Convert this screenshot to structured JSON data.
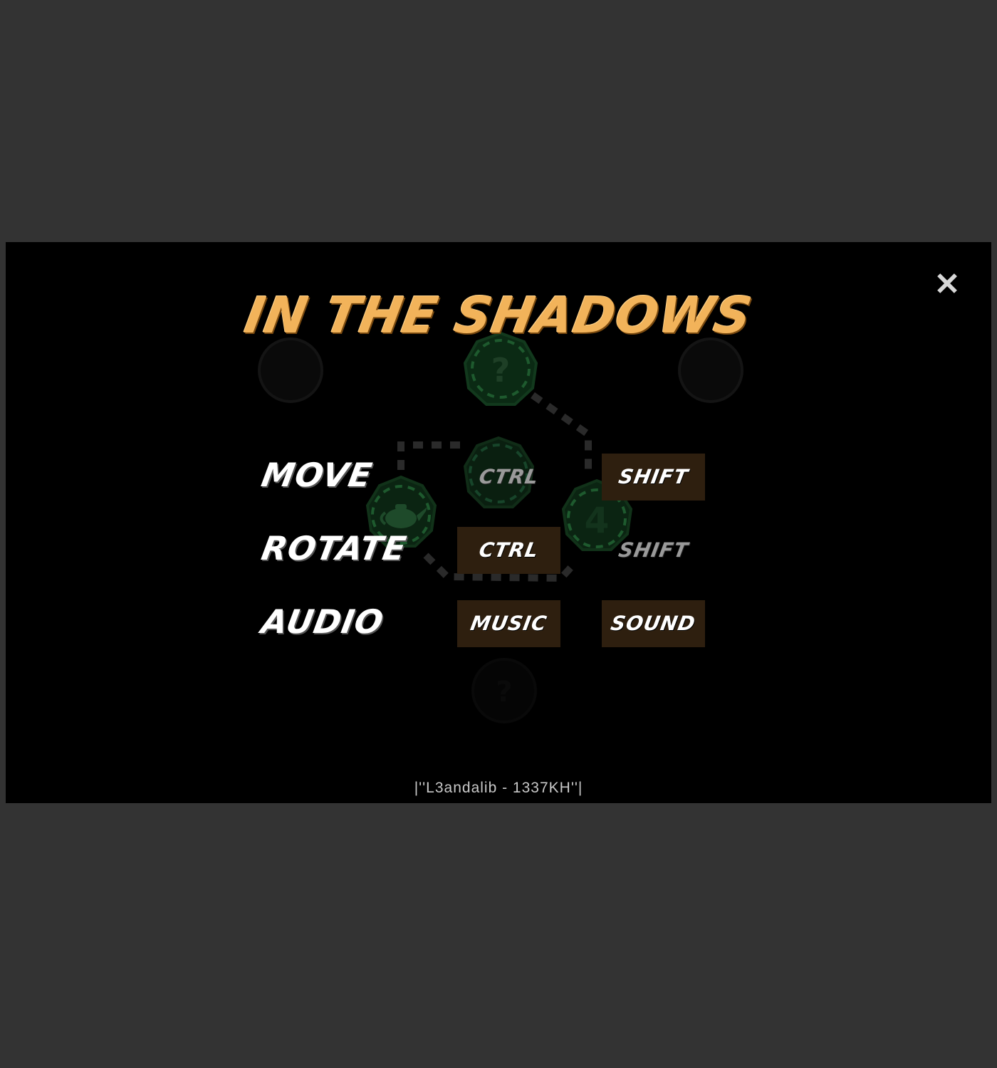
{
  "title": "IN THE SHADOWS",
  "close_icon": "close-icon",
  "controls": {
    "move": {
      "label": "MOVE",
      "options": [
        {
          "label": "CTRL",
          "active": false
        },
        {
          "label": "SHIFT",
          "active": true
        }
      ]
    },
    "rotate": {
      "label": "ROTATE",
      "options": [
        {
          "label": "CTRL",
          "active": true
        },
        {
          "label": "SHIFT",
          "active": false
        }
      ]
    },
    "audio": {
      "label": "AUDIO",
      "options": [
        {
          "label": "MUSIC",
          "active": true
        },
        {
          "label": "SOUND",
          "active": true
        }
      ]
    }
  },
  "credit": "|''L3andalib - 1337KH''|",
  "colors": {
    "page_bg": "#333333",
    "stage_bg": "#000000",
    "title": "#f2b35a",
    "active_option_bg": "#2e1f0f",
    "node_ring": "#1e5a2e"
  },
  "background_map": {
    "nodes": [
      "question-mark-icon",
      "teapot-icon",
      "number-4-icon",
      "question-mark-icon"
    ]
  }
}
